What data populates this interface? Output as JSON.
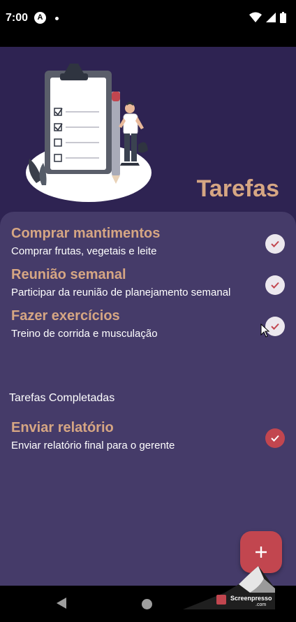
{
  "status_bar": {
    "time": "7:00",
    "notification_letter": "A"
  },
  "header": {
    "title": "Tarefas"
  },
  "tasks": [
    {
      "title": "Comprar mantimentos",
      "description": "Comprar frutas, vegetais e leite",
      "completed": false
    },
    {
      "title": "Reunião semanal",
      "description": "Participar da reunião de planejamento semanal",
      "completed": false
    },
    {
      "title": "Fazer exercícios",
      "description": "Treino de corrida e musculação",
      "completed": false
    }
  ],
  "completed_section": {
    "title": "Tarefas Completadas",
    "tasks": [
      {
        "title": "Enviar relatório",
        "description": "Enviar relatório final para o gerente",
        "completed": true
      }
    ]
  },
  "fab": {
    "icon": "plus-icon"
  },
  "watermark": {
    "brand": "Screenpresso",
    "domain": ".com"
  },
  "colors": {
    "background": "#2e2352",
    "card": "#453b69",
    "accent_text": "#d6a683",
    "accent_red": "#c2464f",
    "check_idle": "#ece8ee"
  }
}
